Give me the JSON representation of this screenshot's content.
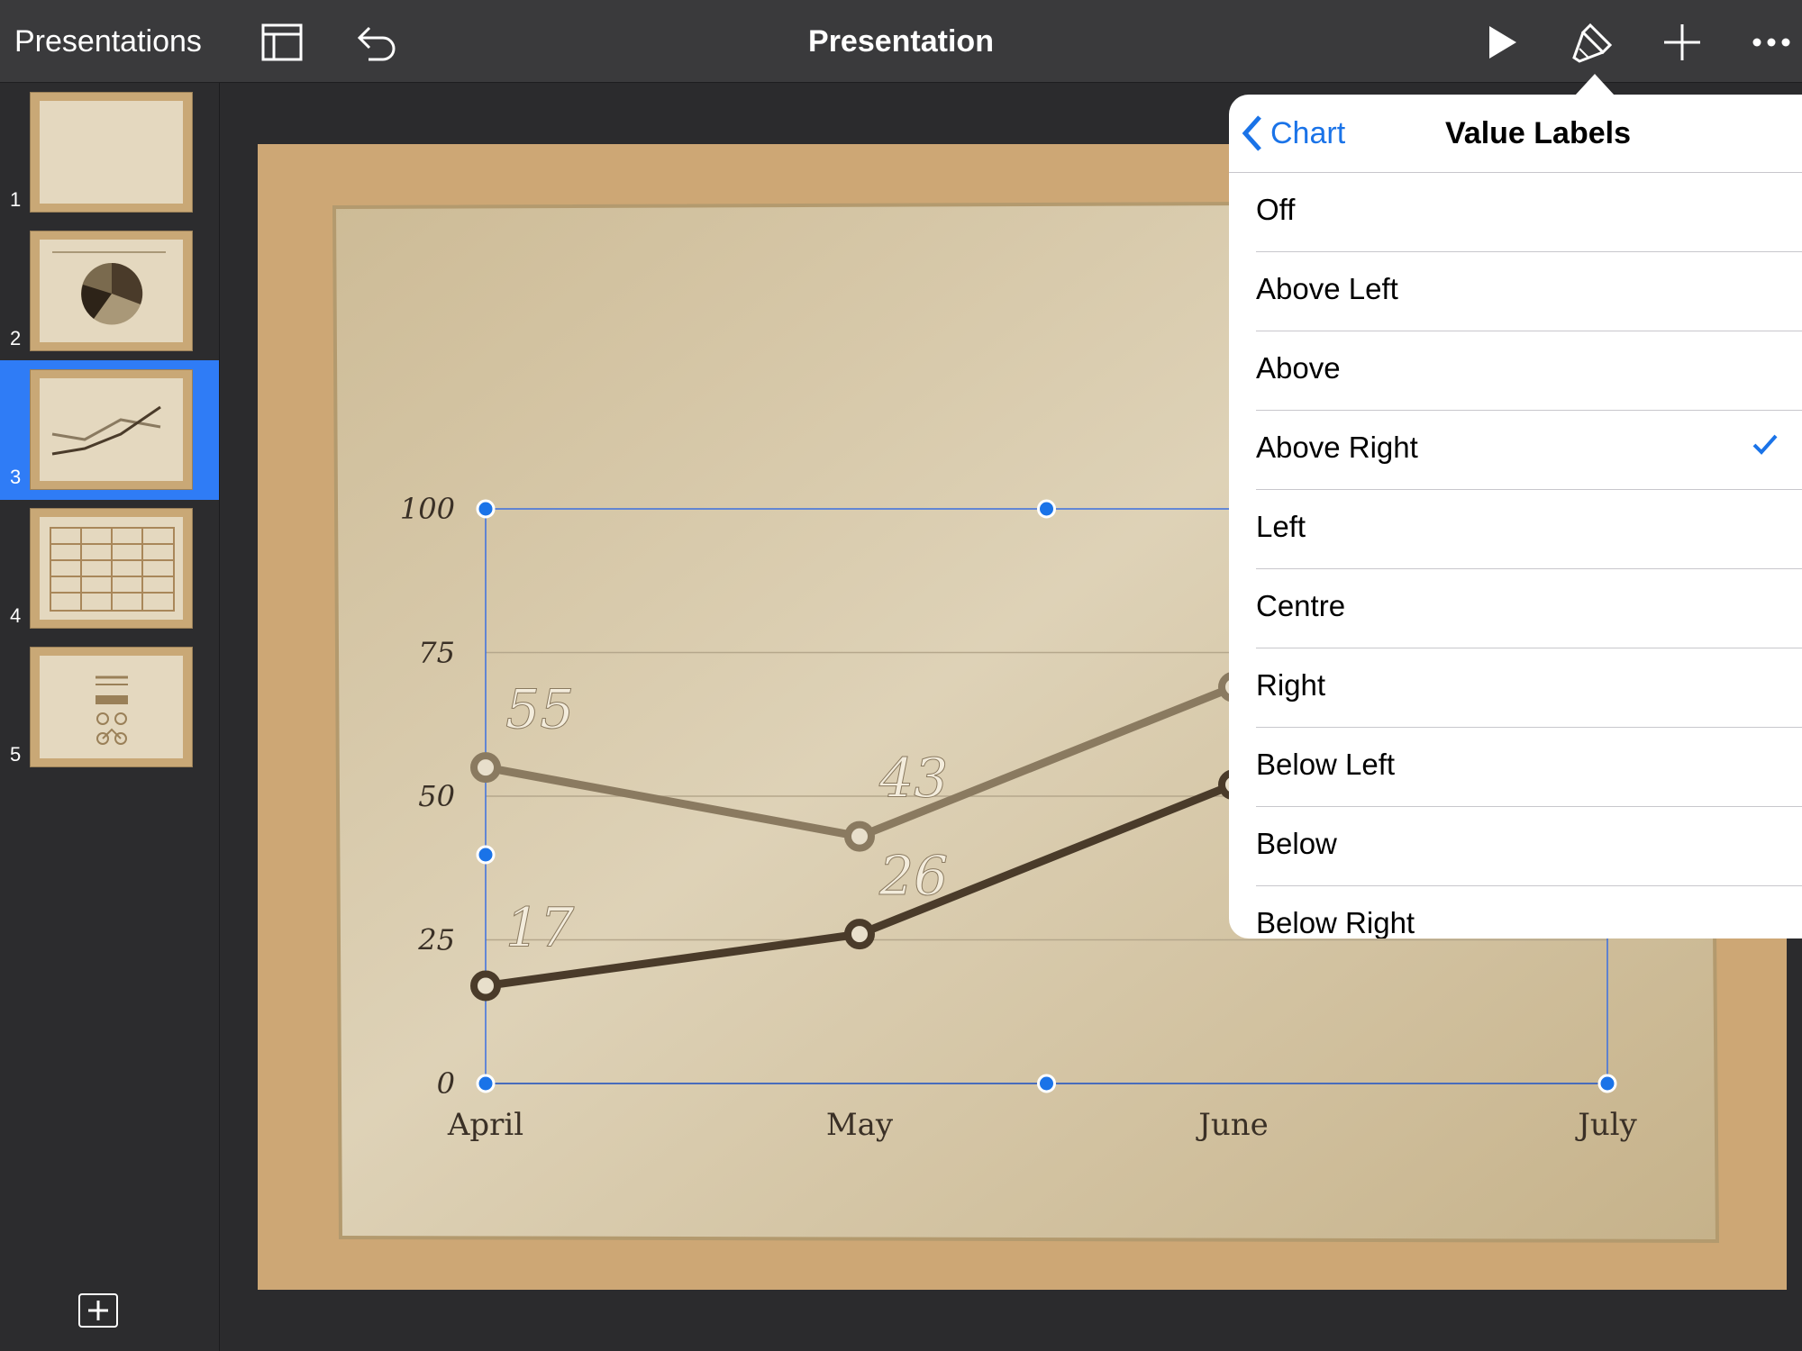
{
  "toolbar": {
    "back_label": "Presentations",
    "title": "Presentation"
  },
  "slides": [
    {
      "number": "1"
    },
    {
      "number": "2"
    },
    {
      "number": "3",
      "selected": true
    },
    {
      "number": "4"
    },
    {
      "number": "5"
    }
  ],
  "chart_data": {
    "type": "line",
    "categories": [
      "April",
      "May",
      "June",
      "July"
    ],
    "y_ticks": [
      "100",
      "75",
      "50",
      "25",
      "0"
    ],
    "ylim": [
      0,
      100
    ],
    "grid": true,
    "series": [
      {
        "values": [
          55,
          43,
          69
        ],
        "data_labels": [
          "55",
          "43"
        ],
        "color": "#8a7a60"
      },
      {
        "values": [
          17,
          26,
          52
        ],
        "data_labels": [
          "17",
          "26"
        ],
        "color": "#4a3b2a"
      }
    ]
  },
  "popover": {
    "back_label": "Chart",
    "title": "Value Labels",
    "options": [
      {
        "label": "Off",
        "checked": false
      },
      {
        "label": "Above Left",
        "checked": false
      },
      {
        "label": "Above",
        "checked": false
      },
      {
        "label": "Above Right",
        "checked": true
      },
      {
        "label": "Left",
        "checked": false
      },
      {
        "label": "Centre",
        "checked": false
      },
      {
        "label": "Right",
        "checked": false
      },
      {
        "label": "Below Left",
        "checked": false
      },
      {
        "label": "Below",
        "checked": false
      },
      {
        "label": "Below Right",
        "checked": false
      }
    ]
  },
  "colors": {
    "accent": "#1a73e8",
    "selection": "#2f7cf6",
    "toolbar": "#3a3a3c"
  }
}
